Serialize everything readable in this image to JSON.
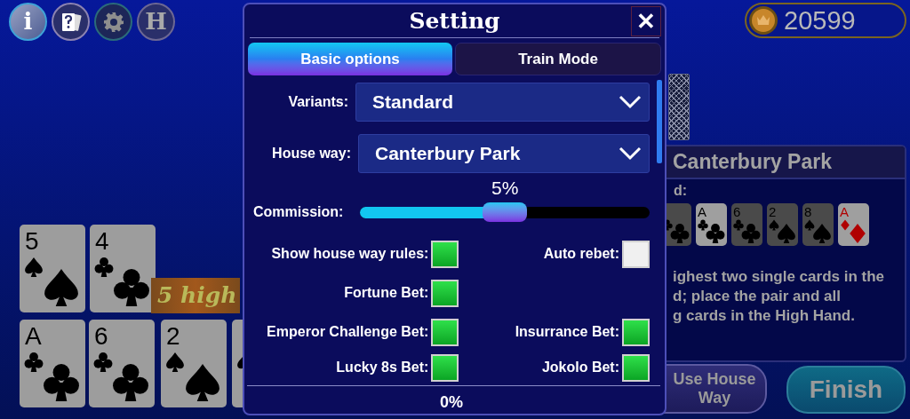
{
  "toolbar": {
    "buttons": [
      {
        "kind": "info",
        "label": "i"
      },
      {
        "kind": "cards"
      },
      {
        "kind": "settings"
      },
      {
        "kind": "letter",
        "label": "H"
      }
    ]
  },
  "coins": {
    "amount": "20599"
  },
  "player_hand": {
    "top_row": [
      {
        "rank": "5",
        "kind": "spades"
      },
      {
        "rank": "4",
        "kind": "clubs"
      }
    ],
    "top_label": "5 high",
    "bottom_row": [
      {
        "rank": "A",
        "kind": "clubs"
      },
      {
        "rank": "6",
        "kind": "clubs"
      },
      {
        "rank": "2",
        "kind": "spades"
      },
      {
        "kind": "spades"
      }
    ]
  },
  "house_way_panel": {
    "title": "Canterbury Park",
    "caption": "d:",
    "cards": [
      {
        "kind": "clubs",
        "highlighted": false
      },
      {
        "rank": "A",
        "kind": "clubs",
        "highlighted": true
      },
      {
        "rank": "6",
        "kind": "clubs",
        "highlighted": false
      },
      {
        "rank": "2",
        "kind": "spades",
        "highlighted": false
      },
      {
        "rank": "8",
        "kind": "spades",
        "highlighted": false
      },
      {
        "rank": "A",
        "kind": "diamonds",
        "highlighted": true
      }
    ],
    "lines": [
      "ighest two single cards in the",
      "d; place the pair and all",
      "g cards in the High Hand."
    ]
  },
  "buttons": [
    {
      "kind": "house",
      "label": "Use House Way"
    },
    {
      "kind": "finish",
      "label": "Finish"
    }
  ],
  "dialog": {
    "title": "Setting",
    "close": "✕",
    "tabs": [
      {
        "label": "Basic options",
        "selected": true
      },
      {
        "label": "Train Mode",
        "selected": false
      }
    ],
    "dropdowns": [
      {
        "label": "Variants:",
        "value": "Standard"
      },
      {
        "label": "House way:",
        "value": "Canterbury Park"
      }
    ],
    "commission": {
      "label": "Commission:",
      "reading": "5%",
      "level": 0.5
    },
    "option_rows": [
      {
        "left": {
          "label": "Show house way rules:",
          "checked": true
        },
        "right": {
          "label": "Auto rebet:",
          "checked": false
        }
      },
      {
        "left": {
          "label": "Fortune Bet:",
          "checked": true
        }
      },
      {
        "left": {
          "label": "Emperor Challenge Bet:",
          "checked": true
        },
        "right": {
          "label": "Insurrance Bet:",
          "checked": true
        }
      },
      {
        "left": {
          "label": "Lucky 8s Bet:",
          "checked": true
        },
        "right": {
          "label": "Jokolo Bet:",
          "checked": true
        }
      }
    ],
    "footer_reading": "0%"
  }
}
